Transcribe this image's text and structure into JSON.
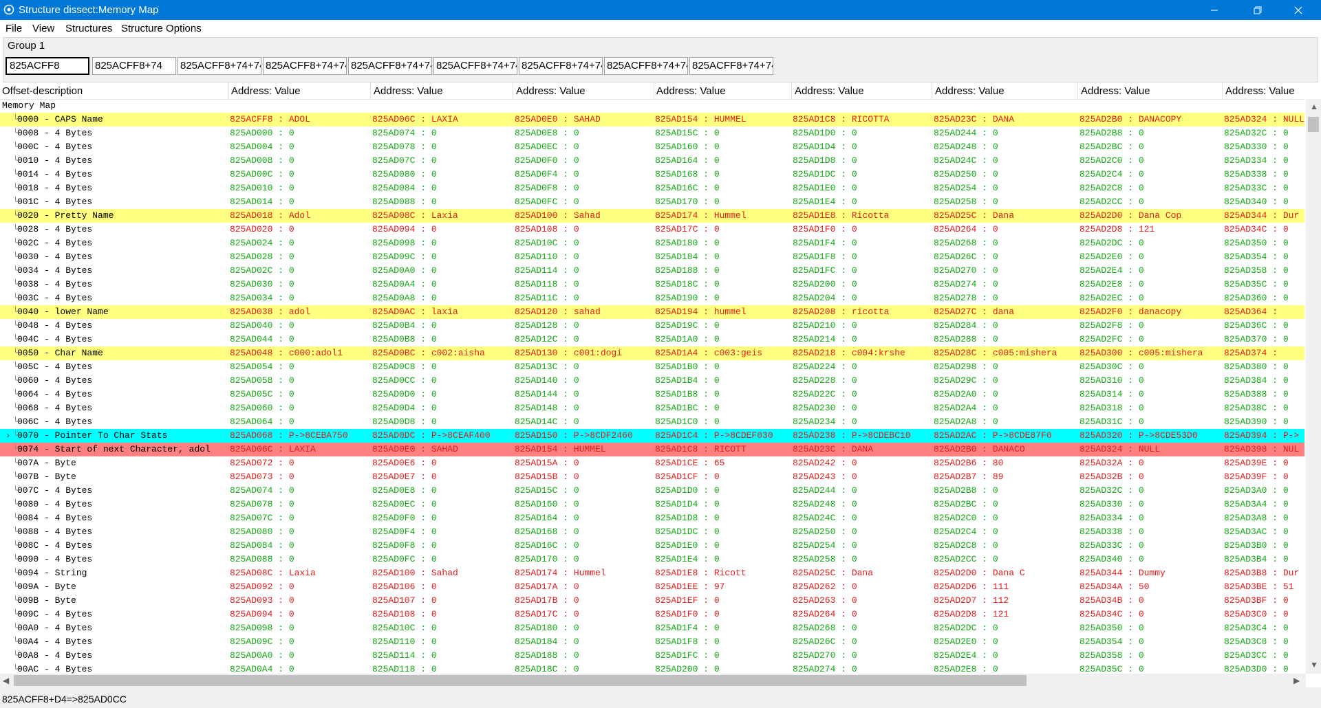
{
  "window": {
    "title": "Structure dissect:Memory Map"
  },
  "menubar": [
    "File",
    "View",
    "Structures",
    "Structure Options"
  ],
  "group": {
    "label": "Group 1",
    "addresses": [
      "825ACFF8",
      "825ACFF8+74",
      "825ACFF8+74+74",
      "825ACFF8+74+74",
      "825ACFF8+74+74",
      "825ACFF8+74+74",
      "825ACFF8+74+74",
      "825ACFF8+74+74",
      "825ACFF8+74+74"
    ]
  },
  "columns": {
    "offset_header": "Offset-description",
    "value_headers": [
      "Address: Value",
      "Address: Value",
      "Address: Value",
      "Address: Value",
      "Address: Value",
      "Address: Value",
      "Address: Value",
      "Address: Value"
    ]
  },
  "root_label": "Memory Map",
  "rows": [
    {
      "desc": "0000 - CAPS Name",
      "hl": "yellow",
      "color": "r",
      "cells": [
        "825ACFF8 : ADOL",
        "825AD06C : LAXIA",
        "825AD0E0 : SAHAD",
        "825AD154 : HUMMEL",
        "825AD1C8 : RICOTTA",
        "825AD23C : DANA",
        "825AD2B0 : DANACOPY",
        "825AD324 : NULL"
      ]
    },
    {
      "desc": "0008 - 4 Bytes",
      "color": "g",
      "cells": [
        "825AD000 : 0",
        "825AD074 : 0",
        "825AD0E8 : 0",
        "825AD15C : 0",
        "825AD1D0 : 0",
        "825AD244 : 0",
        "825AD2B8 : 0",
        "825AD32C : 0"
      ]
    },
    {
      "desc": "000C - 4 Bytes",
      "color": "g",
      "cells": [
        "825AD004 : 0",
        "825AD078 : 0",
        "825AD0EC : 0",
        "825AD160 : 0",
        "825AD1D4 : 0",
        "825AD248 : 0",
        "825AD2BC : 0",
        "825AD330 : 0"
      ]
    },
    {
      "desc": "0010 - 4 Bytes",
      "color": "g",
      "cells": [
        "825AD008 : 0",
        "825AD07C : 0",
        "825AD0F0 : 0",
        "825AD164 : 0",
        "825AD1D8 : 0",
        "825AD24C : 0",
        "825AD2C0 : 0",
        "825AD334 : 0"
      ]
    },
    {
      "desc": "0014 - 4 Bytes",
      "color": "g",
      "cells": [
        "825AD00C : 0",
        "825AD080 : 0",
        "825AD0F4 : 0",
        "825AD168 : 0",
        "825AD1DC : 0",
        "825AD250 : 0",
        "825AD2C4 : 0",
        "825AD338 : 0"
      ]
    },
    {
      "desc": "0018 - 4 Bytes",
      "color": "g",
      "cells": [
        "825AD010 : 0",
        "825AD084 : 0",
        "825AD0F8 : 0",
        "825AD16C : 0",
        "825AD1E0 : 0",
        "825AD254 : 0",
        "825AD2C8 : 0",
        "825AD33C : 0"
      ]
    },
    {
      "desc": "001C - 4 Bytes",
      "color": "g",
      "cells": [
        "825AD014 : 0",
        "825AD088 : 0",
        "825AD0FC : 0",
        "825AD170 : 0",
        "825AD1E4 : 0",
        "825AD258 : 0",
        "825AD2CC : 0",
        "825AD340 : 0"
      ]
    },
    {
      "desc": "0020 - Pretty Name",
      "hl": "yellow",
      "color": "r",
      "cells": [
        "825AD018 : Adol",
        "825AD08C : Laxia",
        "825AD100 : Sahad",
        "825AD174 : Hummel",
        "825AD1E8 : Ricotta",
        "825AD25C : Dana",
        "825AD2D0 : Dana Cop",
        "825AD344 : Dur"
      ]
    },
    {
      "desc": "0028 - 4 Bytes",
      "color": "r",
      "cells": [
        "825AD020 : 0",
        "825AD094 : 0",
        "825AD108 : 0",
        "825AD17C : 0",
        "825AD1F0 : 0",
        "825AD264 : 0",
        "825AD2D8 : 121",
        "825AD34C : 0"
      ]
    },
    {
      "desc": "002C - 4 Bytes",
      "color": "g",
      "cells": [
        "825AD024 : 0",
        "825AD098 : 0",
        "825AD10C : 0",
        "825AD180 : 0",
        "825AD1F4 : 0",
        "825AD268 : 0",
        "825AD2DC : 0",
        "825AD350 : 0"
      ]
    },
    {
      "desc": "0030 - 4 Bytes",
      "color": "g",
      "cells": [
        "825AD028 : 0",
        "825AD09C : 0",
        "825AD110 : 0",
        "825AD184 : 0",
        "825AD1F8 : 0",
        "825AD26C : 0",
        "825AD2E0 : 0",
        "825AD354 : 0"
      ]
    },
    {
      "desc": "0034 - 4 Bytes",
      "color": "g",
      "cells": [
        "825AD02C : 0",
        "825AD0A0 : 0",
        "825AD114 : 0",
        "825AD188 : 0",
        "825AD1FC : 0",
        "825AD270 : 0",
        "825AD2E4 : 0",
        "825AD358 : 0"
      ]
    },
    {
      "desc": "0038 - 4 Bytes",
      "color": "g",
      "cells": [
        "825AD030 : 0",
        "825AD0A4 : 0",
        "825AD118 : 0",
        "825AD18C : 0",
        "825AD200 : 0",
        "825AD274 : 0",
        "825AD2E8 : 0",
        "825AD35C : 0"
      ]
    },
    {
      "desc": "003C - 4 Bytes",
      "color": "g",
      "cells": [
        "825AD034 : 0",
        "825AD0A8 : 0",
        "825AD11C : 0",
        "825AD190 : 0",
        "825AD204 : 0",
        "825AD278 : 0",
        "825AD2EC : 0",
        "825AD360 : 0"
      ]
    },
    {
      "desc": "0040 - lower Name",
      "hl": "yellow",
      "color": "r",
      "cells": [
        "825AD038 : adol",
        "825AD0AC : laxia",
        "825AD120 : sahad",
        "825AD194 : hummel",
        "825AD208 : ricotta",
        "825AD27C : dana",
        "825AD2F0 : danacopy",
        "825AD364 :"
      ]
    },
    {
      "desc": "0048 - 4 Bytes",
      "color": "g",
      "cells": [
        "825AD040 : 0",
        "825AD0B4 : 0",
        "825AD128 : 0",
        "825AD19C : 0",
        "825AD210 : 0",
        "825AD284 : 0",
        "825AD2F8 : 0",
        "825AD36C : 0"
      ]
    },
    {
      "desc": "004C - 4 Bytes",
      "color": "g",
      "cells": [
        "825AD044 : 0",
        "825AD0B8 : 0",
        "825AD12C : 0",
        "825AD1A0 : 0",
        "825AD214 : 0",
        "825AD288 : 0",
        "825AD2FC : 0",
        "825AD370 : 0"
      ]
    },
    {
      "desc": "0050 - Char Name",
      "hl": "yellow",
      "color": "r",
      "cells": [
        "825AD048 : c000:adol1",
        "825AD0BC : c002:aisha",
        "825AD130 : c001:dogi",
        "825AD1A4 : c003:geis",
        "825AD218 : c004:krshe",
        "825AD28C : c005:mishera",
        "825AD300 : c005:mishera",
        "825AD374 :"
      ]
    },
    {
      "desc": "005C - 4 Bytes",
      "color": "g",
      "cells": [
        "825AD054 : 0",
        "825AD0C8 : 0",
        "825AD13C : 0",
        "825AD1B0 : 0",
        "825AD224 : 0",
        "825AD298 : 0",
        "825AD30C : 0",
        "825AD380 : 0"
      ]
    },
    {
      "desc": "0060 - 4 Bytes",
      "color": "g",
      "cells": [
        "825AD058 : 0",
        "825AD0CC : 0",
        "825AD140 : 0",
        "825AD1B4 : 0",
        "825AD228 : 0",
        "825AD29C : 0",
        "825AD310 : 0",
        "825AD384 : 0"
      ]
    },
    {
      "desc": "0064 - 4 Bytes",
      "color": "g",
      "cells": [
        "825AD05C : 0",
        "825AD0D0 : 0",
        "825AD144 : 0",
        "825AD1B8 : 0",
        "825AD22C : 0",
        "825AD2A0 : 0",
        "825AD314 : 0",
        "825AD388 : 0"
      ]
    },
    {
      "desc": "0068 - 4 Bytes",
      "color": "g",
      "cells": [
        "825AD060 : 0",
        "825AD0D4 : 0",
        "825AD148 : 0",
        "825AD1BC : 0",
        "825AD230 : 0",
        "825AD2A4 : 0",
        "825AD318 : 0",
        "825AD38C : 0"
      ]
    },
    {
      "desc": "006C - 4 Bytes",
      "color": "g",
      "cells": [
        "825AD064 : 0",
        "825AD0D8 : 0",
        "825AD14C : 0",
        "825AD1C0 : 0",
        "825AD234 : 0",
        "825AD2A8 : 0",
        "825AD31C : 0",
        "825AD390 : 0"
      ]
    },
    {
      "desc": "0070 - Pointer To Char Stats",
      "hl": "cyan",
      "color": "r",
      "expander": true,
      "cells": [
        "825AD068 : P->8CEBA750",
        "825AD0DC : P->8CEAF400",
        "825AD150 : P->8CDF2460",
        "825AD1C4 : P->8CDEF030",
        "825AD238 : P->8CDEBC10",
        "825AD2AC : P->8CDE87F0",
        "825AD320 : P->8CDE53D0",
        "825AD394 : P->"
      ]
    },
    {
      "desc": "0074 - Start of next Character, adol",
      "hl": "red",
      "color": "r",
      "cells": [
        "825AD06C : LAXIA",
        "825AD0E0 : SAHAD",
        "825AD154 : HUMMEL",
        "825AD1C8 : RICOTT",
        "825AD23C : DANA",
        "825AD2B0 : DANACO",
        "825AD324 : NULL",
        "825AD398 : NUL"
      ]
    },
    {
      "desc": "007A - Byte",
      "color": "r",
      "cells": [
        "825AD072 : 0",
        "825AD0E6 : 0",
        "825AD15A : 0",
        "825AD1CE : 65",
        "825AD242 : 0",
        "825AD2B6 : 80",
        "825AD32A : 0",
        "825AD39E : 0"
      ]
    },
    {
      "desc": "007B - Byte",
      "color": "r",
      "cells": [
        "825AD073 : 0",
        "825AD0E7 : 0",
        "825AD15B : 0",
        "825AD1CF : 0",
        "825AD243 : 0",
        "825AD2B7 : 89",
        "825AD32B : 0",
        "825AD39F : 0"
      ]
    },
    {
      "desc": "007C - 4 Bytes",
      "color": "g",
      "cells": [
        "825AD074 : 0",
        "825AD0E8 : 0",
        "825AD15C : 0",
        "825AD1D0 : 0",
        "825AD244 : 0",
        "825AD2B8 : 0",
        "825AD32C : 0",
        "825AD3A0 : 0"
      ]
    },
    {
      "desc": "0080 - 4 Bytes",
      "color": "g",
      "cells": [
        "825AD078 : 0",
        "825AD0EC : 0",
        "825AD160 : 0",
        "825AD1D4 : 0",
        "825AD248 : 0",
        "825AD2BC : 0",
        "825AD330 : 0",
        "825AD3A4 : 0"
      ]
    },
    {
      "desc": "0084 - 4 Bytes",
      "color": "g",
      "cells": [
        "825AD07C : 0",
        "825AD0F0 : 0",
        "825AD164 : 0",
        "825AD1D8 : 0",
        "825AD24C : 0",
        "825AD2C0 : 0",
        "825AD334 : 0",
        "825AD3A8 : 0"
      ]
    },
    {
      "desc": "0088 - 4 Bytes",
      "color": "g",
      "cells": [
        "825AD080 : 0",
        "825AD0F4 : 0",
        "825AD168 : 0",
        "825AD1DC : 0",
        "825AD250 : 0",
        "825AD2C4 : 0",
        "825AD338 : 0",
        "825AD3AC : 0"
      ]
    },
    {
      "desc": "008C - 4 Bytes",
      "color": "g",
      "cells": [
        "825AD084 : 0",
        "825AD0F8 : 0",
        "825AD16C : 0",
        "825AD1E0 : 0",
        "825AD254 : 0",
        "825AD2C8 : 0",
        "825AD33C : 0",
        "825AD3B0 : 0"
      ]
    },
    {
      "desc": "0090 - 4 Bytes",
      "color": "g",
      "cells": [
        "825AD088 : 0",
        "825AD0FC : 0",
        "825AD170 : 0",
        "825AD1E4 : 0",
        "825AD258 : 0",
        "825AD2CC : 0",
        "825AD340 : 0",
        "825AD3B4 : 0"
      ]
    },
    {
      "desc": "0094 - String",
      "color": "r",
      "cells": [
        "825AD08C : Laxia",
        "825AD100 : Sahad",
        "825AD174 : Hummel",
        "825AD1E8 : Ricott",
        "825AD25C : Dana",
        "825AD2D0 : Dana C",
        "825AD344 : Dummy",
        "825AD3B8 : Dur"
      ]
    },
    {
      "desc": "009A - Byte",
      "color": "r",
      "cells": [
        "825AD092 : 0",
        "825AD106 : 0",
        "825AD17A : 0",
        "825AD1EE : 97",
        "825AD262 : 0",
        "825AD2D6 : 111",
        "825AD34A : 50",
        "825AD3BE : 51"
      ]
    },
    {
      "desc": "009B - Byte",
      "color": "r",
      "cells": [
        "825AD093 : 0",
        "825AD107 : 0",
        "825AD17B : 0",
        "825AD1EF : 0",
        "825AD263 : 0",
        "825AD2D7 : 112",
        "825AD34B : 0",
        "825AD3BF : 0"
      ]
    },
    {
      "desc": "009C - 4 Bytes",
      "color": "r",
      "cells": [
        "825AD094 : 0",
        "825AD108 : 0",
        "825AD17C : 0",
        "825AD1F0 : 0",
        "825AD264 : 0",
        "825AD2D8 : 121",
        "825AD34C : 0",
        "825AD3C0 : 0"
      ]
    },
    {
      "desc": "00A0 - 4 Bytes",
      "color": "g",
      "cells": [
        "825AD098 : 0",
        "825AD10C : 0",
        "825AD180 : 0",
        "825AD1F4 : 0",
        "825AD268 : 0",
        "825AD2DC : 0",
        "825AD350 : 0",
        "825AD3C4 : 0"
      ]
    },
    {
      "desc": "00A4 - 4 Bytes",
      "color": "g",
      "cells": [
        "825AD09C : 0",
        "825AD110 : 0",
        "825AD184 : 0",
        "825AD1F8 : 0",
        "825AD26C : 0",
        "825AD2E0 : 0",
        "825AD354 : 0",
        "825AD3C8 : 0"
      ]
    },
    {
      "desc": "00A8 - 4 Bytes",
      "color": "g",
      "cells": [
        "825AD0A0 : 0",
        "825AD114 : 0",
        "825AD188 : 0",
        "825AD1FC : 0",
        "825AD270 : 0",
        "825AD2E4 : 0",
        "825AD358 : 0",
        "825AD3CC : 0"
      ]
    },
    {
      "desc": "00AC - 4 Bytes",
      "color": "g",
      "cells": [
        "825AD0A4 : 0",
        "825AD118 : 0",
        "825AD18C : 0",
        "825AD200 : 0",
        "825AD274 : 0",
        "825AD2E8 : 0",
        "825AD35C : 0",
        "825AD3D0 : 0"
      ]
    }
  ],
  "status": "825ACFF8+D4=>825AD0CC",
  "colors": {
    "titlebar": "#0078d7",
    "highlight_yellow": "#ffff80",
    "highlight_cyan": "#00ffff",
    "highlight_red": "#ff8080",
    "value_green": "#11aa11",
    "value_red": "#e61a1a"
  }
}
